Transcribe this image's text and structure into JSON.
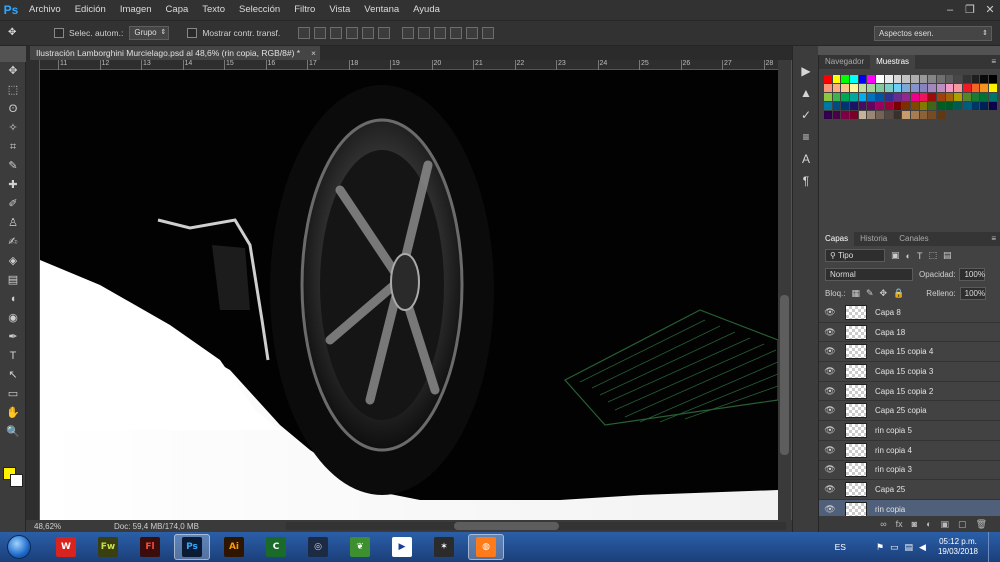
{
  "app": {
    "logo": "Ps"
  },
  "menu": [
    "Archivo",
    "Edición",
    "Imagen",
    "Capa",
    "Texto",
    "Selección",
    "Filtro",
    "Vista",
    "Ventana",
    "Ayuda"
  ],
  "window_controls": {
    "minimize": "–",
    "restore": "❐",
    "close": "✕"
  },
  "options": {
    "tool_glyph": "✥",
    "auto_select_label": "Selec. autom.:",
    "auto_select_value": "Grupo",
    "transform_label": "Mostrar contr. transf.",
    "workspace": "Aspectos esen."
  },
  "document": {
    "tab_title": "Ilustración Lamborghini Murcielago.psd al 48,6% (rin copia, RGB/8#) *",
    "close": "×",
    "zoom": "48,62%",
    "doc_size": "Doc: 59,4 MB/174,0 MB"
  },
  "ruler_ticks": [
    "11",
    "12",
    "13",
    "14",
    "15",
    "16",
    "17",
    "18",
    "19",
    "20",
    "21",
    "22",
    "23",
    "24",
    "25",
    "26",
    "27",
    "28"
  ],
  "tools": [
    "✥",
    "⬚",
    "ʘ",
    "✧",
    "⌗",
    "✎",
    "✚",
    "✐",
    "♙",
    "✍",
    "◈",
    "▤",
    "◖",
    "◉",
    "✒",
    "T",
    "↖",
    "▭",
    "✋",
    "🔍"
  ],
  "colors": {
    "foreground": "#fff200",
    "background": "#ffffff"
  },
  "strip_icons": [
    "▶",
    "▲",
    "✓",
    "≡",
    "A",
    "¶"
  ],
  "swatches_panel": {
    "tabs": [
      "Navegador",
      "Muestras"
    ],
    "active_tab": "Muestras"
  },
  "swatches": [
    "#ff0000",
    "#ffff00",
    "#00ff00",
    "#00ffff",
    "#0000ff",
    "#ff00ff",
    "#ffffff",
    "#ebebeb",
    "#d6d6d6",
    "#c2c2c2",
    "#adadad",
    "#999999",
    "#858585",
    "#707070",
    "#5c5c5c",
    "#474747",
    "#333333",
    "#1f1f1f",
    "#0a0a0a",
    "#000000",
    "#f7977a",
    "#f9ad81",
    "#fdc68a",
    "#fff79a",
    "#c4df9b",
    "#a2d39c",
    "#82ca9d",
    "#7bcdc8",
    "#6ecff6",
    "#7ea7d8",
    "#8493ca",
    "#8882be",
    "#a187be",
    "#bc8dbf",
    "#f49ac2",
    "#f6989d",
    "#ed1c24",
    "#f26522",
    "#f7941d",
    "#fff200",
    "#8dc73f",
    "#39b54a",
    "#00a651",
    "#00a99d",
    "#00aeef",
    "#0072bc",
    "#0054a6",
    "#2e3192",
    "#662d91",
    "#92278f",
    "#ec008c",
    "#ed145b",
    "#9e0b0f",
    "#a0410d",
    "#a3620a",
    "#aba000",
    "#598527",
    "#197b30",
    "#007236",
    "#00746b",
    "#0076a3",
    "#004b80",
    "#003471",
    "#1b1464",
    "#440e62",
    "#630460",
    "#9e005d",
    "#9e0039",
    "#790000",
    "#7b2e00",
    "#7d4900",
    "#827b00",
    "#406618",
    "#005e20",
    "#005826",
    "#005952",
    "#005b7f",
    "#003663",
    "#002157",
    "#0d004c",
    "#32004b",
    "#4b0049",
    "#7b0046",
    "#7a0026",
    "#c7b299",
    "#998675",
    "#736357",
    "#534741",
    "#37302d",
    "#c69c6d",
    "#a67c52",
    "#8c6239",
    "#754c24",
    "#603913"
  ],
  "layers_panel": {
    "tabs": [
      "Capas",
      "Historia",
      "Canales"
    ],
    "active_tab": "Capas",
    "filter": "Tipo",
    "blend_mode": "Normal",
    "opacity_label": "Opacidad:",
    "opacity": "100%",
    "lock_label": "Bloq.:",
    "fill_label": "Relleno:",
    "fill": "100%",
    "layers": [
      {
        "name": "Capa 8"
      },
      {
        "name": "Capa 18"
      },
      {
        "name": "Capa 15 copia 4"
      },
      {
        "name": "Capa 15 copia 3"
      },
      {
        "name": "Capa 15 copia 2"
      },
      {
        "name": "Capa 25 copia"
      },
      {
        "name": "rin copia 5"
      },
      {
        "name": "rin copia 4"
      },
      {
        "name": "rin copia 3"
      },
      {
        "name": "Capa 25"
      },
      {
        "name": "rin copia",
        "selected": true
      }
    ],
    "footer_icons": [
      "∞",
      "fx",
      "◙",
      "◐",
      "▣",
      "▢",
      "🗑"
    ]
  },
  "taskbar": {
    "apps": [
      {
        "label": "W",
        "bg": "#d8231e",
        "fg": "#ffffff"
      },
      {
        "label": "Fw",
        "bg": "#3a3f12",
        "fg": "#c8e04a"
      },
      {
        "label": "Fl",
        "bg": "#3b0c0c",
        "fg": "#ff4a3d"
      },
      {
        "label": "Ps",
        "bg": "#0b1b33",
        "fg": "#31a8ff",
        "active": true
      },
      {
        "label": "Ai",
        "bg": "#2d1500",
        "fg": "#ff9a00"
      },
      {
        "label": "C",
        "bg": "#1a6b2a",
        "fg": "#ffffff"
      },
      {
        "label": "◎",
        "bg": "#1d2a44",
        "fg": "#cfd8e8"
      },
      {
        "label": "❦",
        "bg": "#3d8f2f",
        "fg": "#ffffff"
      },
      {
        "label": "▶",
        "bg": "#ffffff",
        "fg": "#1c3b9a"
      },
      {
        "label": "✶",
        "bg": "#2b2b2b",
        "fg": "#ffffff"
      },
      {
        "label": "◍",
        "bg": "#ff7a18",
        "fg": "#ffffff",
        "active": true
      }
    ],
    "language": "ES",
    "time": "05:12 p.m.",
    "date": "19/03/2018"
  }
}
